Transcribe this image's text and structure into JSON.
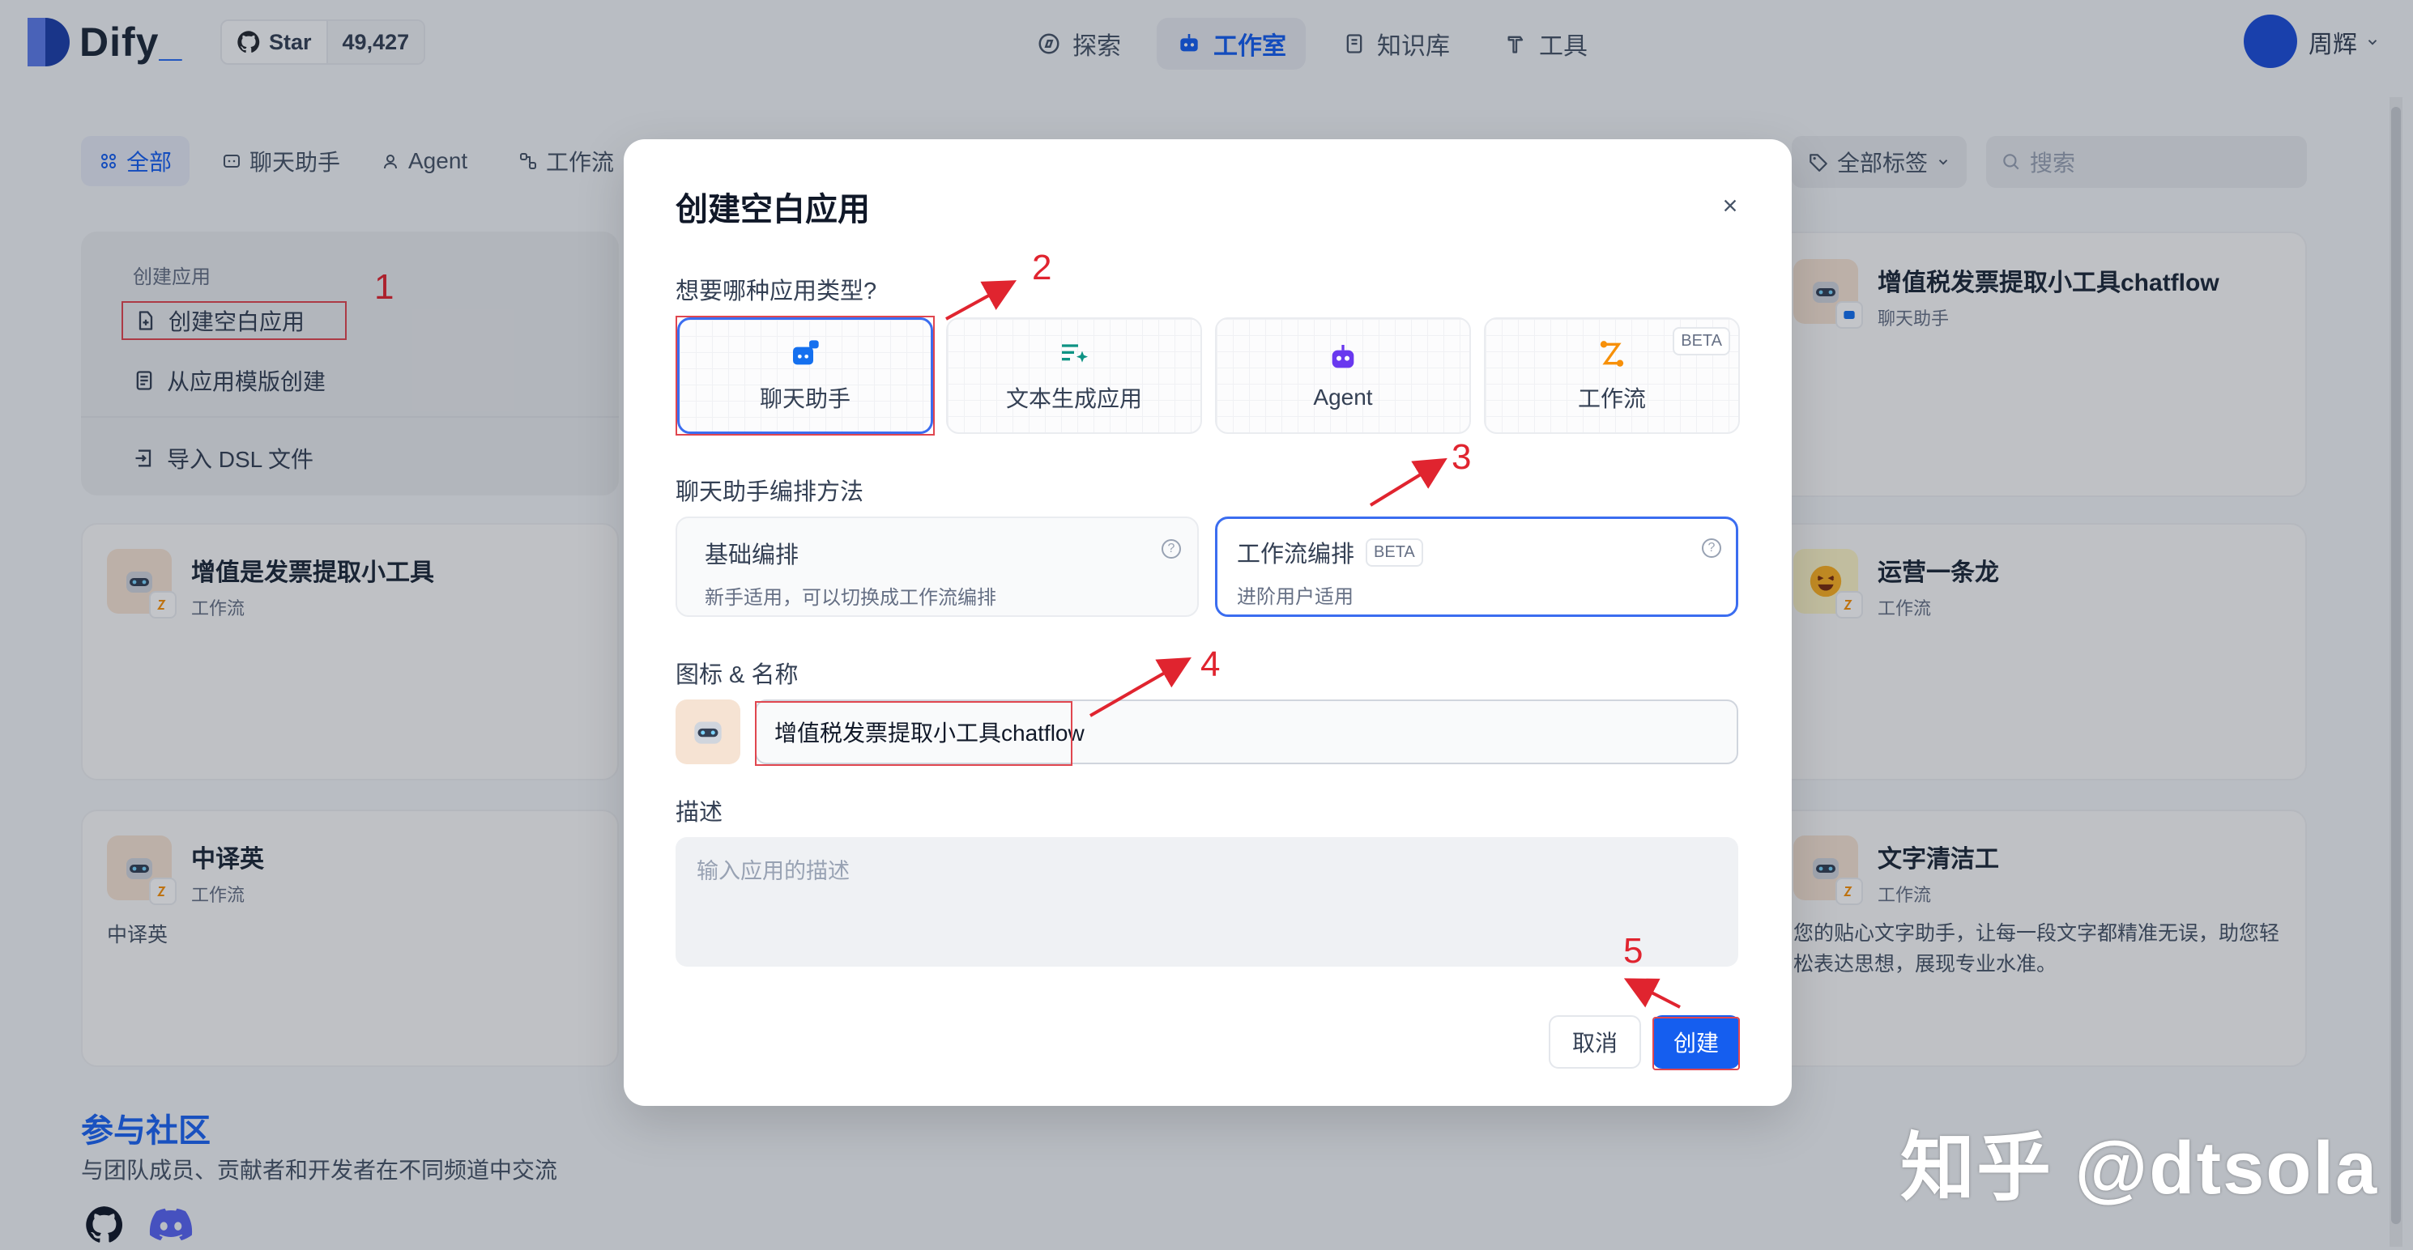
{
  "header": {
    "logo_text": "Dify",
    "logo_underscore": "_",
    "star_label": "Star",
    "star_count": "49,427",
    "nav": [
      {
        "label": "探索",
        "icon": "compass-icon"
      },
      {
        "label": "工作室",
        "icon": "robot-icon"
      },
      {
        "label": "知识库",
        "icon": "book-icon"
      },
      {
        "label": "工具",
        "icon": "hammer-icon"
      }
    ],
    "user_name": "周辉"
  },
  "filters": {
    "chips": [
      {
        "label": "全部",
        "icon": "grid-icon"
      },
      {
        "label": "聊天助手",
        "icon": "chat-icon"
      },
      {
        "label": "Agent",
        "icon": "agent-icon"
      },
      {
        "label": "工作流",
        "icon": "workflow-icon"
      }
    ],
    "tag_filter": "全部标签",
    "search_placeholder": "搜索"
  },
  "create_panel": {
    "label": "创建应用",
    "blank": "创建空白应用",
    "template": "从应用模版创建",
    "import": "导入 DSL 文件"
  },
  "cards": [
    {
      "title": "增值是发票提取小工具",
      "type": "工作流",
      "desc": ""
    },
    {
      "title": "中译英",
      "type": "工作流",
      "desc": "中译英"
    },
    {
      "title": "增值税发票提取小工具chatflow",
      "type": "聊天助手",
      "desc": ""
    },
    {
      "title": "运营一条龙",
      "type": "工作流",
      "desc": ""
    },
    {
      "title": "文字清洁工",
      "type": "工作流",
      "desc": "您的贴心文字助手，让每一段文字都精准无误，助您轻松表达思想，展现专业水准。"
    }
  ],
  "modal": {
    "title": "创建空白应用",
    "type_label": "想要哪种应用类型?",
    "types": [
      {
        "label": "聊天助手"
      },
      {
        "label": "文本生成应用"
      },
      {
        "label": "Agent"
      },
      {
        "label": "工作流",
        "badge": "BETA"
      }
    ],
    "method_label": "聊天助手编排方法",
    "methods": [
      {
        "title": "基础编排",
        "desc": "新手适用，可以切换成工作流编排"
      },
      {
        "title": "工作流编排",
        "badge": "BETA",
        "desc": "进阶用户适用"
      }
    ],
    "name_label": "图标 & 名称",
    "name_value": "增值税发票提取小工具chatflow",
    "desc_label": "描述",
    "desc_placeholder": "输入应用的描述",
    "cancel": "取消",
    "create": "创建"
  },
  "community": {
    "title": "参与社区",
    "desc": "与团队成员、贡献者和开发者在不同频道中交流"
  },
  "annotations": [
    "1",
    "2",
    "3",
    "4",
    "5"
  ],
  "watermark": "知乎 @dtsola",
  "colors": {
    "accent": "#155eef",
    "annotation": "#e0242f"
  }
}
